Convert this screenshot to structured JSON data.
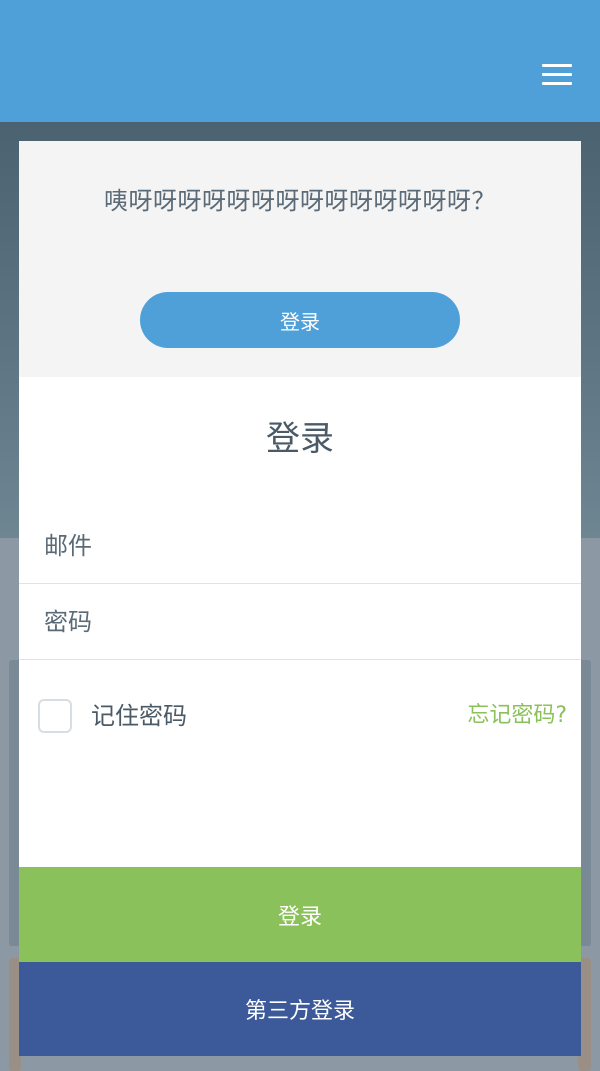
{
  "header": {
    "menu_icon": "hamburger-menu-icon",
    "bar_color": "#4fa0d8"
  },
  "promo": {
    "text": "咦呀呀呀呀呀呀呀呀呀呀呀呀呀呀？",
    "login_label": "登录"
  },
  "form": {
    "title": "登录",
    "email_placeholder": "邮件",
    "password_placeholder": "密码",
    "remember_label": "记住密码",
    "forgot_label": "忘记密码?",
    "submit_label": "登录",
    "third_party_label": "第三方登录"
  },
  "colors": {
    "accent_blue": "#4fa0d8",
    "accent_green": "#8bc15a",
    "third_party_blue": "#3c5a99"
  }
}
